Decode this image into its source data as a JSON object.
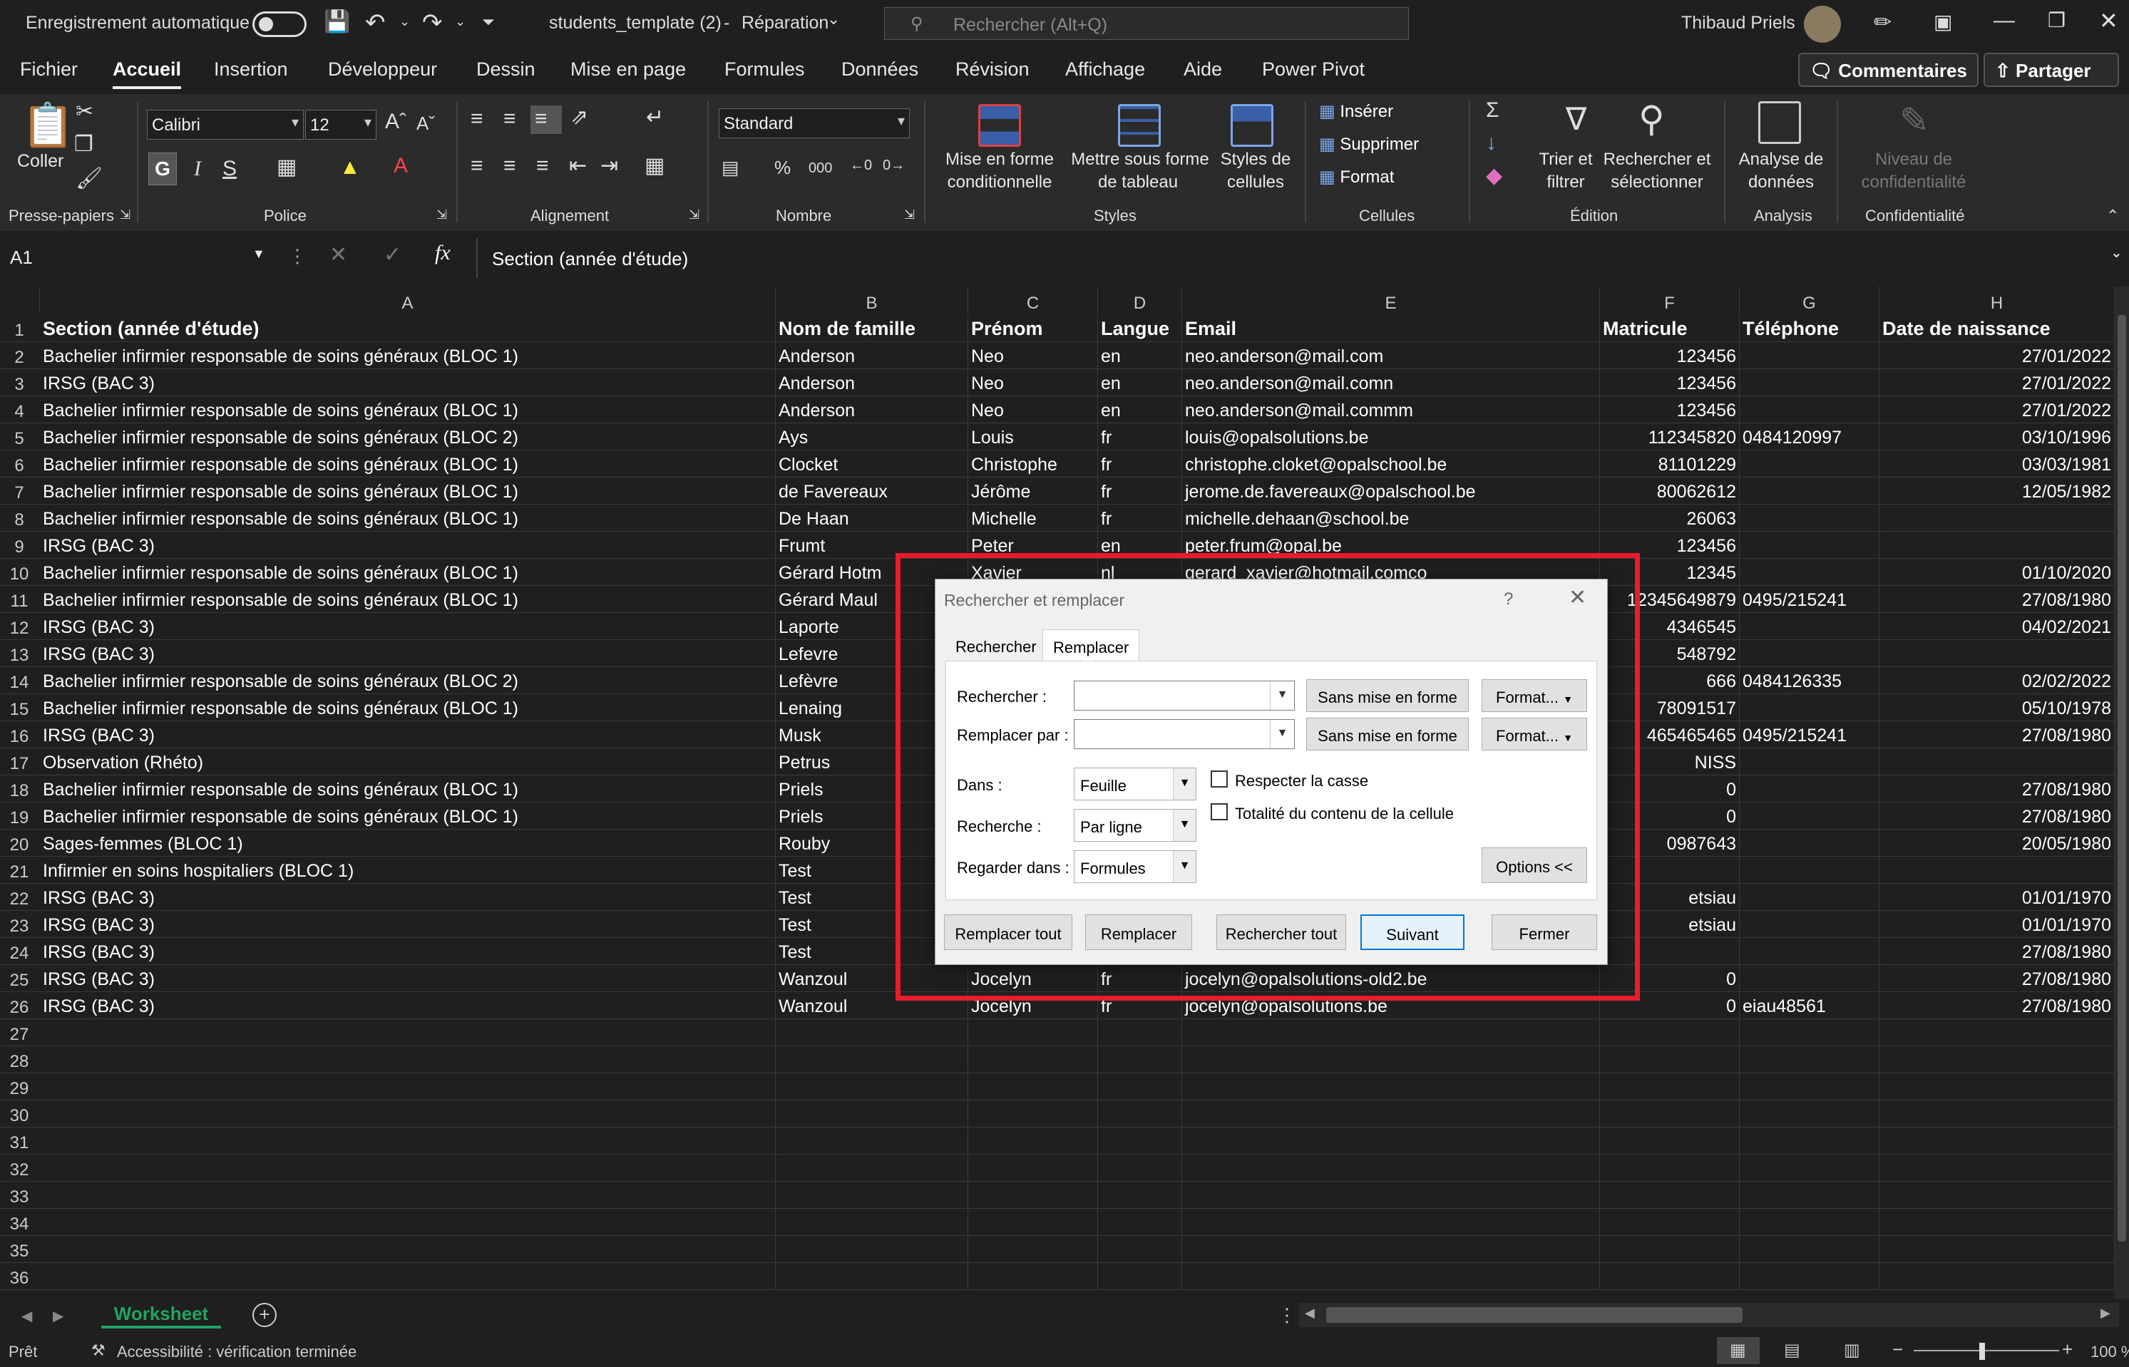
{
  "titlebar": {
    "autosave_label": "Enregistrement automatique",
    "filename": "students_template (2)",
    "separator": "-",
    "mode": "Réparation",
    "search_placeholder": "Rechercher (Alt+Q)",
    "user_name": "Thibaud Priels"
  },
  "menu": {
    "items": [
      "Fichier",
      "Accueil",
      "Insertion",
      "Développeur",
      "Dessin",
      "Mise en page",
      "Formules",
      "Données",
      "Révision",
      "Affichage",
      "Aide",
      "Power Pivot"
    ],
    "active": "Accueil",
    "comments_label": "Commentaires",
    "share_label": "Partager"
  },
  "ribbon": {
    "paste_label": "Coller",
    "font_name": "Calibri",
    "font_size": "12",
    "bold_label": "G",
    "italic_label": "I",
    "underline_label": "S",
    "number_format": "Standard",
    "percent_label": "%",
    "thousands_label": "000",
    "cond_format_label_1": "Mise en forme",
    "cond_format_label_2": "conditionnelle",
    "table_format_label_1": "Mettre sous forme",
    "table_format_label_2": "de tableau",
    "cell_styles_label_1": "Styles de",
    "cell_styles_label_2": "cellules",
    "insert_label": "Insérer",
    "delete_label": "Supprimer",
    "format_label": "Format",
    "sort_label_1": "Trier et",
    "sort_label_2": "filtrer",
    "find_label_1": "Rechercher et",
    "find_label_2": "sélectionner",
    "analyze_label_1": "Analyse de",
    "analyze_label_2": "données",
    "sensitivity_label_1": "Niveau de",
    "sensitivity_label_2": "confidentialité",
    "groups": {
      "clipboard": "Presse-papiers",
      "font": "Police",
      "alignment": "Alignement",
      "number": "Nombre",
      "styles": "Styles",
      "cells": "Cellules",
      "editing": "Édition",
      "analysis": "Analysis",
      "sensitivity": "Confidentialité"
    }
  },
  "formula_bar": {
    "name_box": "A1",
    "fx_label": "fx",
    "formula": "Section (année d'étude)"
  },
  "sheet": {
    "columns": [
      "A",
      "B",
      "C",
      "D",
      "E",
      "F",
      "G",
      "H"
    ],
    "row_numbers": [
      "1",
      "2",
      "3",
      "4",
      "5",
      "6",
      "7",
      "8",
      "9",
      "10",
      "11",
      "12",
      "13",
      "14",
      "15",
      "16",
      "17",
      "18",
      "19",
      "20",
      "21",
      "22",
      "23",
      "24",
      "25",
      "26",
      "27",
      "28",
      "29",
      "30",
      "31",
      "32",
      "33",
      "34",
      "35",
      "36"
    ],
    "rows": [
      [
        "Section (année d'étude)",
        "Nom de famille",
        "Prénom",
        "Langue",
        "Email",
        "Matricule",
        "Téléphone",
        "Date de naissance"
      ],
      [
        "Bachelier infirmier responsable de soins généraux (BLOC 1)",
        "Anderson",
        "Neo",
        "en",
        "neo.anderson@mail.com",
        "123456",
        "",
        "27/01/2022"
      ],
      [
        "IRSG (BAC 3)",
        "Anderson",
        "Neo",
        "en",
        "neo.anderson@mail.comn",
        "123456",
        "",
        "27/01/2022"
      ],
      [
        "Bachelier infirmier responsable de soins généraux (BLOC 1)",
        "Anderson",
        "Neo",
        "en",
        "neo.anderson@mail.commm",
        "123456",
        "",
        "27/01/2022"
      ],
      [
        "Bachelier infirmier responsable de soins généraux (BLOC 2)",
        "Ays",
        "Louis",
        "fr",
        "louis@opalsolutions.be",
        "112345820",
        "0484120997",
        "03/10/1996"
      ],
      [
        "Bachelier infirmier responsable de soins généraux (BLOC 1)",
        "Clocket",
        "Christophe",
        "fr",
        "christophe.cloket@opalschool.be",
        "81101229",
        "",
        "03/03/1981"
      ],
      [
        "Bachelier infirmier responsable de soins généraux (BLOC 1)",
        "de Favereaux",
        "Jérôme",
        "fr",
        "jerome.de.favereaux@opalschool.be",
        "80062612",
        "",
        "12/05/1982"
      ],
      [
        "Bachelier infirmier responsable de soins généraux (BLOC 1)",
        "De Haan",
        "Michelle",
        "fr",
        "michelle.dehaan@school.be",
        "26063",
        "",
        ""
      ],
      [
        "IRSG (BAC 3)",
        "Frumt",
        "Peter",
        "en",
        "peter.frum@opal.be",
        "123456",
        "",
        ""
      ],
      [
        "Bachelier infirmier responsable de soins généraux (BLOC 1)",
        "Gérard Hotm",
        "Xavier",
        "nl",
        "gerard_xavier@hotmail.comco",
        "12345",
        "",
        "01/10/2020"
      ],
      [
        "Bachelier infirmier responsable de soins généraux (BLOC 1)",
        "Gérard Maul",
        "",
        "",
        "",
        "12345649879",
        "0495/215241",
        "27/08/1980"
      ],
      [
        "IRSG (BAC 3)",
        "Laporte",
        "",
        "",
        "",
        "4346545",
        "",
        "04/02/2021"
      ],
      [
        "IRSG (BAC 3)",
        "Lefevre",
        "",
        "",
        "",
        "548792",
        "",
        ""
      ],
      [
        "Bachelier infirmier responsable de soins généraux (BLOC 2)",
        "Lefèvre",
        "",
        "",
        "",
        "666",
        "0484126335",
        "02/02/2022"
      ],
      [
        "Bachelier infirmier responsable de soins généraux (BLOC 1)",
        "Lenaing",
        "",
        "",
        "",
        "78091517",
        "",
        "05/10/1978"
      ],
      [
        "IRSG (BAC 3)",
        "Musk",
        "",
        "",
        "",
        "465465465",
        "0495/215241",
        "27/08/1980"
      ],
      [
        "Observation (Rhéto)",
        "Petrus",
        "",
        "",
        "",
        "NISS",
        "",
        ""
      ],
      [
        "Bachelier infirmier responsable de soins généraux (BLOC 1)",
        "Priels",
        "",
        "",
        "",
        "0",
        "",
        "27/08/1980"
      ],
      [
        "Bachelier infirmier responsable de soins généraux (BLOC 1)",
        "Priels",
        "",
        "",
        "",
        "0",
        "",
        "27/08/1980"
      ],
      [
        "Sages-femmes (BLOC 1)",
        "Rouby",
        "",
        "",
        "",
        "0987643",
        "",
        "20/05/1980"
      ],
      [
        "Infirmier en soins hospitaliers (BLOC 1)",
        "Test",
        "",
        "",
        "",
        "",
        "",
        ""
      ],
      [
        "IRSG (BAC 3)",
        "Test",
        "",
        "",
        "",
        "etsiau",
        "",
        "01/01/1970"
      ],
      [
        "IRSG (BAC 3)",
        "Test",
        "",
        "",
        "",
        "etsiau",
        "",
        "01/01/1970"
      ],
      [
        "IRSG (BAC 3)",
        "Test",
        "",
        "",
        "",
        "",
        "",
        "27/08/1980"
      ],
      [
        "IRSG (BAC 3)",
        "Wanzoul",
        "Jocelyn",
        "fr",
        "jocelyn@opalsolutions-old2.be",
        "0",
        "",
        "27/08/1980"
      ],
      [
        "IRSG (BAC 3)",
        "Wanzoul",
        "Jocelyn",
        "fr",
        "jocelyn@opalsolutions.be",
        "0",
        "eiau48561",
        "27/08/1980"
      ]
    ]
  },
  "dialog": {
    "title": "Rechercher et remplacer",
    "help": "?",
    "tabs": [
      "Rechercher",
      "Remplacer"
    ],
    "active_tab": "Remplacer",
    "find_label": "Rechercher :",
    "replace_label": "Remplacer par :",
    "find_value": "",
    "replace_value": "",
    "no_format_label": "Sans mise en forme",
    "format_label": "Format...",
    "within_label": "Dans :",
    "within_value": "Feuille",
    "search_label": "Recherche :",
    "search_value": "Par ligne",
    "look_in_label": "Regarder dans :",
    "look_in_value": "Formules",
    "match_case_label": "Respecter la casse",
    "match_entire_label": "Totalité du contenu de la cellule",
    "options_label": "Options <<",
    "replace_all_label": "Remplacer tout",
    "replace_btn_label": "Remplacer",
    "find_all_label": "Rechercher tout",
    "find_next_label": "Suivant",
    "close_label": "Fermer"
  },
  "sheet_tabs": {
    "active": "Worksheet"
  },
  "status": {
    "ready": "Prêt",
    "accessibility": "Accessibilité : vérification terminée",
    "zoom": "100 %"
  },
  "colors": {
    "accent_green": "#33a852",
    "highlight_red": "#e81c2a",
    "sheet_tab_text": "#21a366"
  }
}
